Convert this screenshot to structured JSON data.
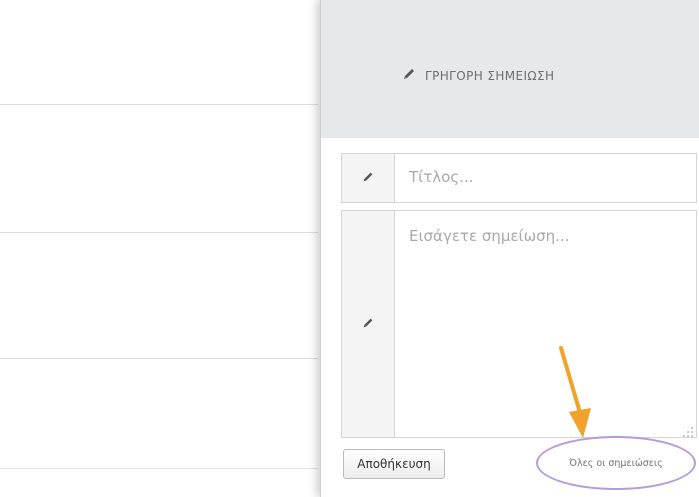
{
  "panel": {
    "header_title": "ΓΡΗΓΟΡΗ ΣΗΜΕΙΩΣΗ",
    "title_placeholder": "Τίτλος...",
    "note_placeholder": "Εισάγετε σημείωση...",
    "save_label": "Αποθήκευση",
    "all_notes_label": "Όλες οι σημειώσεις"
  },
  "colors": {
    "header_bg": "#e7e8e9",
    "annotation_arrow": "#f0a22a",
    "annotation_circle": "#b59bd8"
  },
  "icons": {
    "header": "pencil-icon",
    "title_field": "pencil-icon",
    "note_field": "pencil-icon"
  }
}
